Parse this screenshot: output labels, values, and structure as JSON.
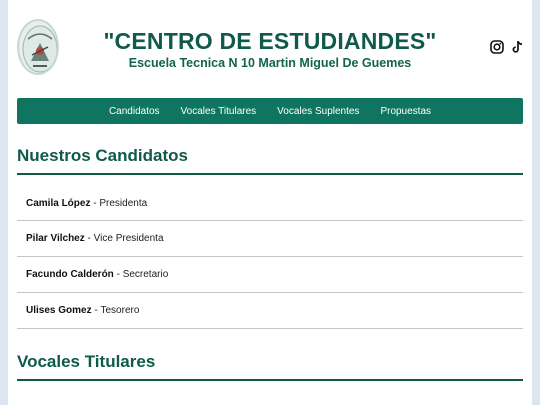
{
  "header": {
    "title": "\"CENTRO DE ESTUDIANDES\"",
    "subtitle": "Escuela Tecnica N 10 Martin Miguel De Guemes"
  },
  "social": [
    {
      "icon": "instagram-icon"
    },
    {
      "icon": "tiktok-icon"
    }
  ],
  "nav": {
    "items": [
      "Candidatos",
      "Vocales Titulares",
      "Vocales Suplentes",
      "Propuestas"
    ]
  },
  "candidates": {
    "heading": "Nuestros Candidatos",
    "list": [
      {
        "name": "Camila López",
        "role": "Presidenta"
      },
      {
        "name": "Pilar Vilchez",
        "role": "Vice Presidenta"
      },
      {
        "name": "Facundo Calderón",
        "role": "Secretario"
      },
      {
        "name": "Ulises Gomez",
        "role": "Tesorero"
      }
    ]
  },
  "vocales_titulares": {
    "heading": "Vocales Titulares"
  },
  "colors": {
    "brand": "#107560",
    "heading": "#0f5a48",
    "background": "#dde6ee"
  }
}
